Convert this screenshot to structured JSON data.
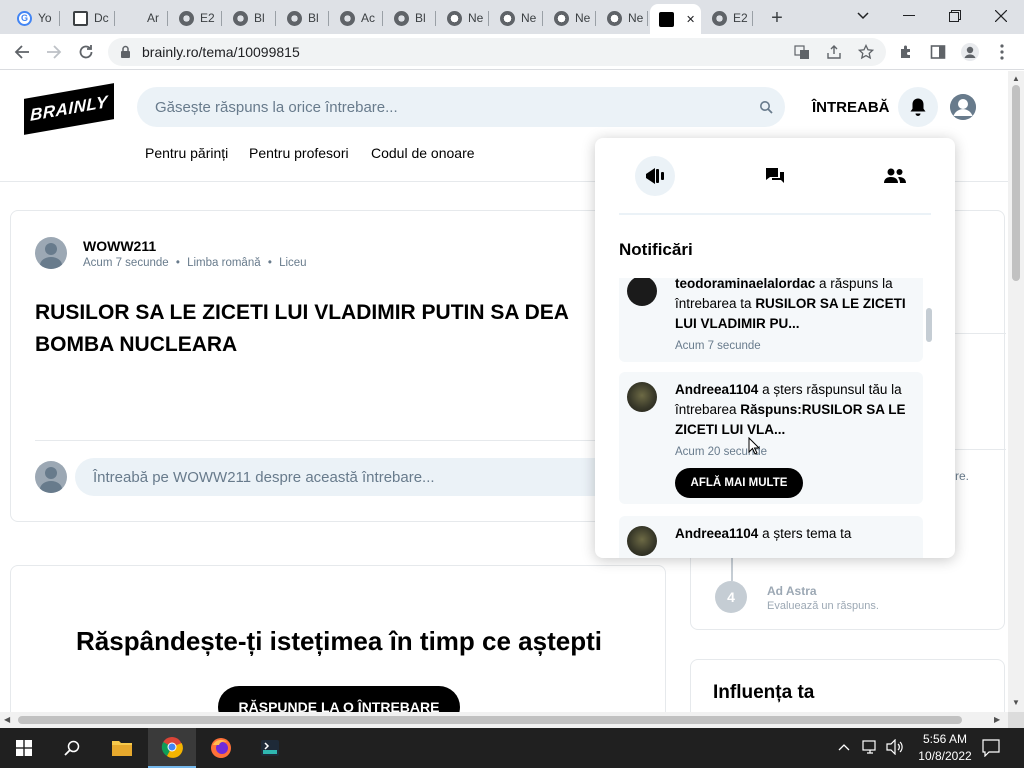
{
  "browser": {
    "tabs": [
      {
        "label": "Yo",
        "icon": "google-icon",
        "color": "#ffffff"
      },
      {
        "label": "Dc",
        "icon": "doc-icon",
        "color": "#3c4043"
      },
      {
        "label": "Ar",
        "icon": "blank-icon",
        "color": "#dee1e6"
      },
      {
        "label": "E2",
        "icon": "globe-icon",
        "color": "#5f6368"
      },
      {
        "label": "Bl",
        "icon": "globe-icon",
        "color": "#5f6368"
      },
      {
        "label": "Bl",
        "icon": "globe-icon",
        "color": "#5f6368"
      },
      {
        "label": "Ac",
        "icon": "globe-icon",
        "color": "#5f6368"
      },
      {
        "label": "Bl",
        "icon": "globe-icon",
        "color": "#5f6368"
      },
      {
        "label": "Ne",
        "icon": "chrome-icon",
        "color": "#5f6368"
      },
      {
        "label": "Ne",
        "icon": "chrome-icon",
        "color": "#5f6368"
      },
      {
        "label": "Ne",
        "icon": "chrome-icon",
        "color": "#5f6368"
      },
      {
        "label": "Ne",
        "icon": "chrome-icon",
        "color": "#5f6368"
      },
      {
        "label": "",
        "icon": "brainly-icon",
        "color": "#000000",
        "active": true
      },
      {
        "label": "E2",
        "icon": "globe-icon",
        "color": "#5f6368"
      }
    ],
    "url": "brainly.ro/tema/10099815"
  },
  "site": {
    "logo": "BRAINLY",
    "search_placeholder": "Găsește răspuns la orice întrebare...",
    "ask_label": "ÎNTREABĂ",
    "nav": [
      "Pentru părinți",
      "Pentru profesori",
      "Codul de onoare"
    ]
  },
  "question": {
    "author": "WOWW211",
    "meta": [
      "Acum 7 secunde",
      "Limba română",
      "Liceu"
    ],
    "title": "RUSILOR SA LE ZICETI LUI VLADIMIR PUTIN SA DEA BOMBA NUCLEARA",
    "ask_placeholder": "Întreabă pe WOWW211 despre această întrebare..."
  },
  "promo": {
    "title": "Răspândește-ți istețimea în timp ce aștepti",
    "button": "RĂSPUNDE LA O ÎNTREBARE"
  },
  "sidebar": {
    "step_number": "4",
    "step_title": "Ad Astra",
    "step_sub": "Evaluează un răspuns.",
    "peek_text": "re.",
    "influence_title": "Influența ta"
  },
  "notifications": {
    "title": "Notificări",
    "items": [
      {
        "user": "teodoraminaelalordac",
        "action": " a răspuns la întrebarea ta ",
        "subject": "RUSILOR SA LE ZICETI LUI VLADIMIR PU...",
        "time": "Acum 7 secunde"
      },
      {
        "user": "Andreea1104",
        "action": " a șters răspunsul tău la întrebarea ",
        "subject": "Răspuns:RUSILOR SA LE ZICETI LUI VLA...",
        "time": "Acum 20 secunde",
        "button": "AFLĂ MAI MULTE"
      },
      {
        "user": "Andreea1104",
        "action": " a șters tema ta",
        "subject": "",
        "time": ""
      }
    ]
  },
  "taskbar": {
    "time": "5:56 AM",
    "date": "10/8/2022"
  },
  "colors": {
    "accent_bg": "#ebf2f7",
    "muted_text": "#687b8c",
    "black_button": "#000000"
  }
}
